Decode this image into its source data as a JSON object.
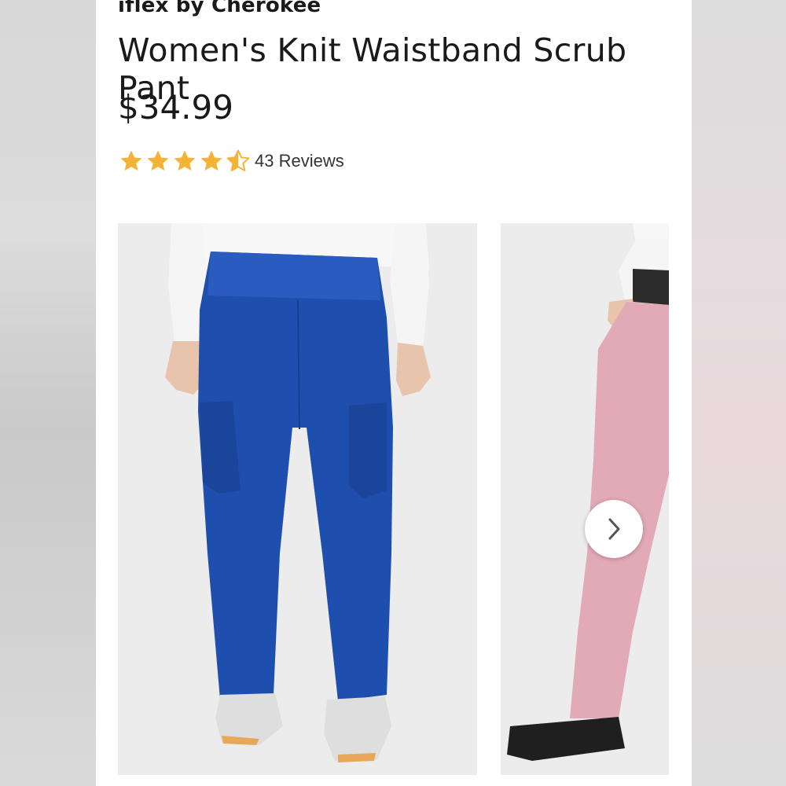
{
  "product": {
    "brand": "iflex by Cherokee",
    "title": "Women's Knit Waistband Scrub Pant",
    "price": "$34.99",
    "rating": 4.5,
    "reviews_label": "43 Reviews"
  },
  "colors": {
    "star": "#f4b336",
    "navy_pant": "#1f4fae",
    "pink_pant": "#e2a9b6"
  },
  "carousel": {
    "slides": [
      {
        "color_name": "royal blue"
      },
      {
        "color_name": "pink"
      }
    ],
    "next_icon": "chevron-right-icon"
  }
}
